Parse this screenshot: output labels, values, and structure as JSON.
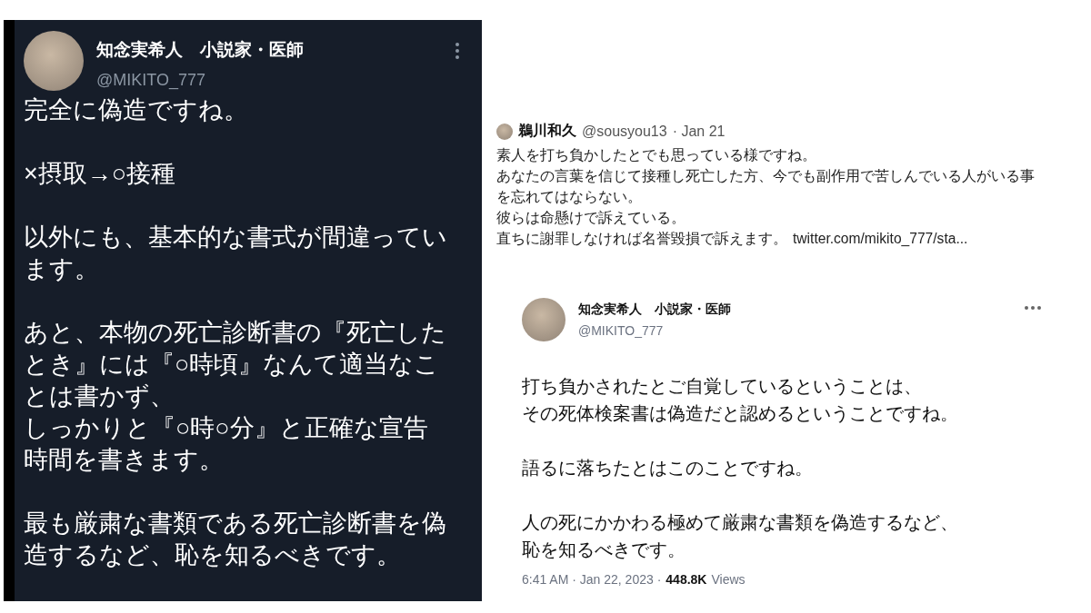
{
  "left_tweet": {
    "name": "知念実希人　小説家・医師",
    "handle": "@MIKITO_777",
    "paragraphs": [
      "完全に偽造ですね。",
      "×摂取→○接種",
      "以外にも、基本的な書式が間違っています。",
      "あと、本物の死亡診断書の『死亡したとき』には『○時頃』なんて適当なことは書かず、",
      "しっかりと『○時○分』と正確な宣告時間を書きます。",
      "最も厳粛な書類である死亡診断書を偽造するなど、恥を知るべきです。"
    ]
  },
  "reply": {
    "name": "鵜川和久",
    "handle": "@sousyou13",
    "date": "· Jan 21",
    "lines": [
      "素人を打ち負かしたとでも思っている様ですね。",
      "あなたの言葉を信じて接種し死亡した方、今でも副作用で苦しんでいる人がいる事を忘れてはならない。",
      "彼らは命懸けで訴えている。",
      "直ちに謝罪しなければ名誉毀損で訴えます。"
    ],
    "link": "twitter.com/mikito_777/sta..."
  },
  "quoted": {
    "name": "知念実希人　小説家・医師",
    "handle": "@MIKITO_777",
    "paragraphs": [
      [
        "打ち負かされたとご自覚しているということは、",
        "その死体検案書は偽造だと認めるということですね。"
      ],
      [
        "語るに落ちたとはこのことですね。"
      ],
      [
        "人の死にかかわる極めて厳粛な書類を偽造するなど、",
        "恥を知るべきです。"
      ]
    ],
    "meta": "6:41 AM · Jan 22, 2023 ·",
    "views_count": "448.8K",
    "views_label": "Views"
  }
}
